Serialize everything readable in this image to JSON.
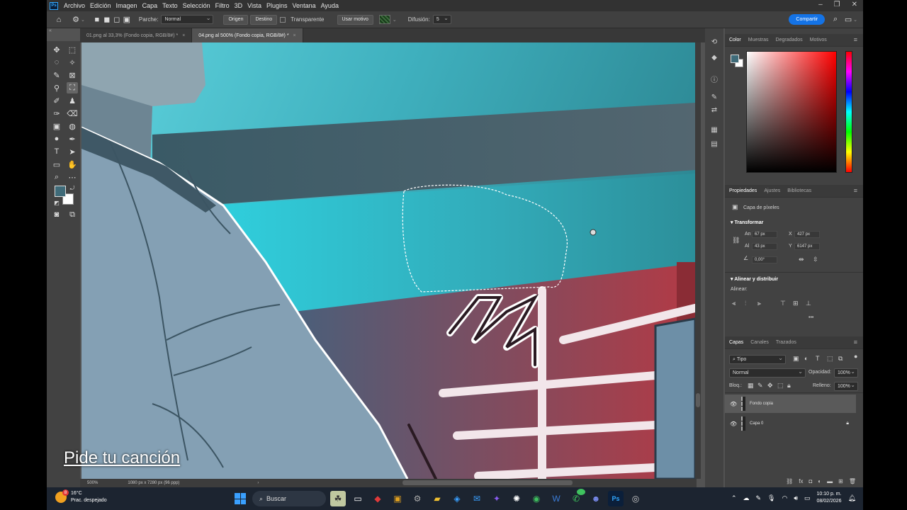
{
  "app": {
    "logo": "Ps"
  },
  "menu": [
    "Archivo",
    "Edición",
    "Imagen",
    "Capa",
    "Texto",
    "Selección",
    "Filtro",
    "3D",
    "Vista",
    "Plugins",
    "Ventana",
    "Ayuda"
  ],
  "options": {
    "parche_label": "Parche:",
    "parche_value": "Normal",
    "origen": "Origen",
    "destino": "Destino",
    "transparente": "Transparente",
    "usar_motivo": "Usar motivo",
    "difusion_label": "Difusión:",
    "difusion_value": "5",
    "share": "Compartir"
  },
  "tabs": [
    {
      "label": "01.png al 33,3% (Fondo copia, RGB/8#) *",
      "active": false
    },
    {
      "label": "04.png al 500% (Fondo copia, RGB/8#) *",
      "active": true
    }
  ],
  "colors": {
    "foreground": "#3f6b79",
    "background": "#ffffff",
    "accent": "#1473e6"
  },
  "status": {
    "zoom": "500%",
    "dimensions": "1080 px x 7280 px (96 ppp)"
  },
  "color_panel": {
    "tabs": [
      "Color",
      "Muestras",
      "Degradados",
      "Motivos"
    ]
  },
  "properties": {
    "tabs": [
      "Propiedades",
      "Ajustes",
      "Bibliotecas"
    ],
    "layer_type": "Capa de píxeles",
    "transform_title": "Transformar",
    "an_label": "An",
    "an_value": "67 px",
    "x_label": "X",
    "x_value": "427 px",
    "al_label": "Al",
    "al_value": "43 px",
    "y_label": "Y",
    "y_value": "6147 px",
    "angle_value": "0,00°",
    "align_title": "Alinear y distribuir",
    "align_label": "Alinear:",
    "more": "•••"
  },
  "layers": {
    "tabs": [
      "Capas",
      "Canales",
      "Trazados"
    ],
    "filter": "Tipo",
    "blend": "Normal",
    "opacity_label": "Opacidad:",
    "opacity_value": "100%",
    "lock_label": "Bloq.:",
    "fill_label": "Relleno:",
    "fill_value": "100%",
    "items": [
      {
        "name": "Fondo copia",
        "selected": true,
        "locked": false
      },
      {
        "name": "Capa 0",
        "selected": false,
        "locked": true
      }
    ]
  },
  "overlay_text": "Pide tu canción",
  "taskbar": {
    "temperature": "16°C",
    "weather": "Prac. despejado",
    "weather_badge": "8",
    "search": "Buscar",
    "badge_count": "23",
    "time": "10:10 p. m.",
    "date": "08/02/2026"
  }
}
